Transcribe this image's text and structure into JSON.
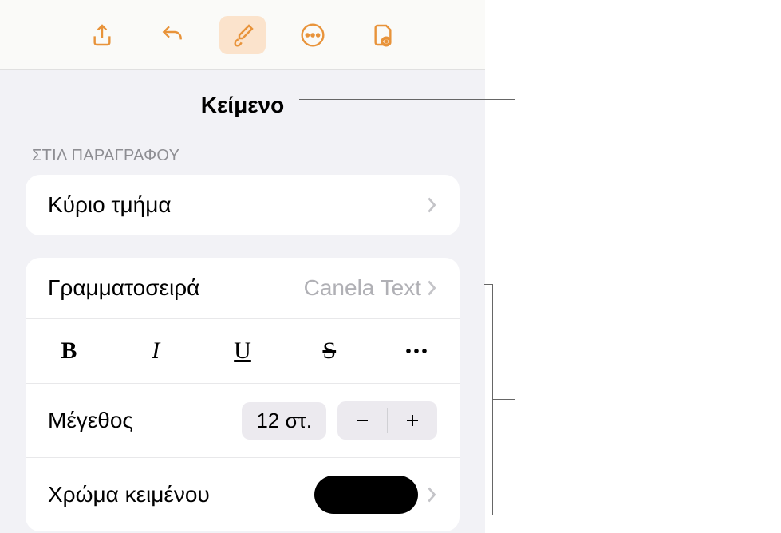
{
  "toolbar": {
    "icons": [
      "share",
      "undo",
      "format",
      "more",
      "view"
    ]
  },
  "tab": {
    "title": "Κείμενο"
  },
  "section": {
    "paragraphStyle": "ΣΤΙΛ ΠΑΡΑΓΡΑΦΟΥ"
  },
  "paragraph": {
    "value": "Κύριο τμήμα"
  },
  "font": {
    "label": "Γραμματοσειρά",
    "value": "Canela Text"
  },
  "styles": {
    "bold": "B",
    "italic": "I",
    "underline": "U",
    "strike": "S"
  },
  "size": {
    "label": "Μέγεθος",
    "value": "12 στ."
  },
  "color": {
    "label": "Χρώμα κειμένου",
    "value": "#000000"
  }
}
